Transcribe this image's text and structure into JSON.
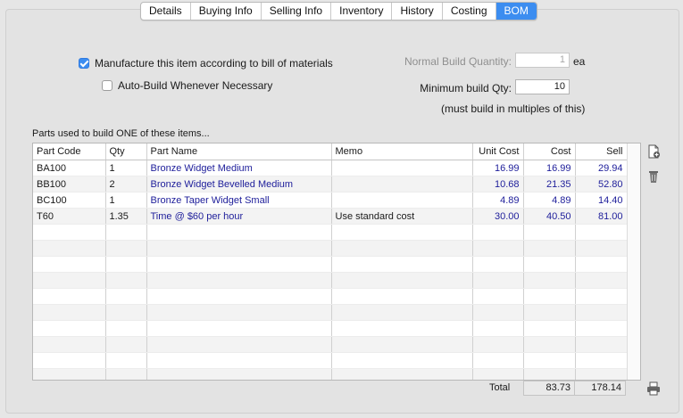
{
  "tabs": [
    "Details",
    "Buying Info",
    "Selling Info",
    "Inventory",
    "History",
    "Costing",
    "BOM"
  ],
  "active_tab": "BOM",
  "options": {
    "manufacture_label": "Manufacture this item according to bill of materials",
    "manufacture_checked": true,
    "autobuild_label": "Auto-Build Whenever Necessary",
    "autobuild_checked": false
  },
  "build": {
    "normal_qty_label": "Normal Build Quantity:",
    "normal_qty_value": "1",
    "normal_qty_unit": "ea",
    "min_qty_label": "Minimum build Qty:",
    "min_qty_value": "10",
    "multiples_note": "(must build in multiples of this)"
  },
  "parts_caption": "Parts used to build ONE of these items...",
  "table": {
    "headers": [
      "Part Code",
      "Qty",
      "Part Name",
      "Memo",
      "Unit Cost",
      "Cost",
      "Sell"
    ],
    "rows": [
      [
        "BA100",
        "1",
        "Bronze Widget Medium",
        "",
        "16.99",
        "16.99",
        "29.94"
      ],
      [
        "BB100",
        "2",
        "Bronze Widget Bevelled Medium",
        "",
        "10.68",
        "21.35",
        "52.80"
      ],
      [
        "BC100",
        "1",
        "Bronze Taper Widget Small",
        "",
        "4.89",
        "4.89",
        "14.40"
      ],
      [
        "T60",
        "1.35",
        "Time @ $60 per hour",
        "Use standard cost",
        "30.00",
        "40.50",
        "81.00"
      ]
    ],
    "empty_rows": 10
  },
  "totals": {
    "label": "Total",
    "cost": "83.73",
    "sell": "178.14"
  },
  "icons": {
    "add": "add-document-icon",
    "delete": "trash-icon",
    "print": "printer-icon"
  },
  "colors": {
    "accent": "#3c8df0",
    "value_text": "#1d1d9a"
  }
}
